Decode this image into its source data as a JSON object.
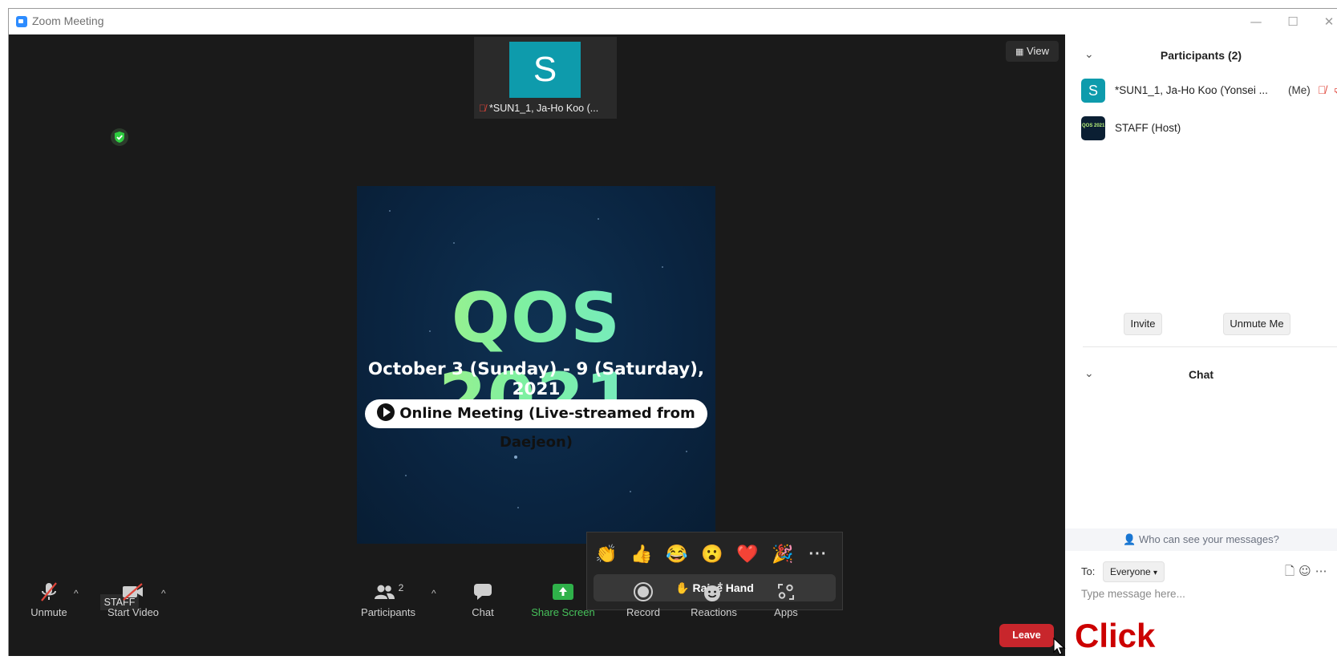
{
  "window": {
    "title": "Zoom Meeting",
    "minimize": "—",
    "maximize": "☐",
    "close": "✕"
  },
  "stage": {
    "view_label": "View",
    "thumbnail": {
      "initial": "S",
      "name": "*SUN1_1, Ja-Ho Koo (..."
    },
    "tooltip": "STAFF"
  },
  "poster": {
    "title": "QOS 2021",
    "dates": "October 3 (Sunday) - 9 (Saturday), 2021",
    "pill": "Online Meeting (Live-streamed from Daejeon)"
  },
  "reactions": {
    "emojis": [
      "👏",
      "👍",
      "😂",
      "😮",
      "❤️",
      "🎉"
    ],
    "more": "···",
    "raise_hand": "✋ Raise Hand"
  },
  "toolbar": {
    "unmute": "Unmute",
    "start_video": "Start Video",
    "participants": "Participants",
    "participants_count": "2",
    "chat": "Chat",
    "share_screen": "Share Screen",
    "record": "Record",
    "reactions": "Reactions",
    "apps": "Apps",
    "leave": "Leave"
  },
  "panel": {
    "participants_title": "Participants (2)",
    "participants": [
      {
        "initial": "S",
        "name": "*SUN1_1, Ja-Ho Koo (Yonsei ...",
        "tag": "(Me)",
        "avatar_color": "#0e9bac"
      },
      {
        "initial": "QOS 2021",
        "name": "STAFF (Host)",
        "tag": "",
        "avatar_color": "#0b1f33"
      }
    ],
    "invite": "Invite",
    "unmute_me": "Unmute Me",
    "chat_title": "Chat",
    "who_can_see": "Who can see your messages?",
    "to_label": "To:",
    "to_value": "Everyone",
    "message_placeholder": "Type message here..."
  },
  "annotation": {
    "text": "Click"
  },
  "colors": {
    "stage_bg": "#1a1a1a",
    "leave_red": "#c8262c",
    "share_green": "#46c05a",
    "muted_red": "#e0453a",
    "annotation_red": "#cc0000"
  }
}
